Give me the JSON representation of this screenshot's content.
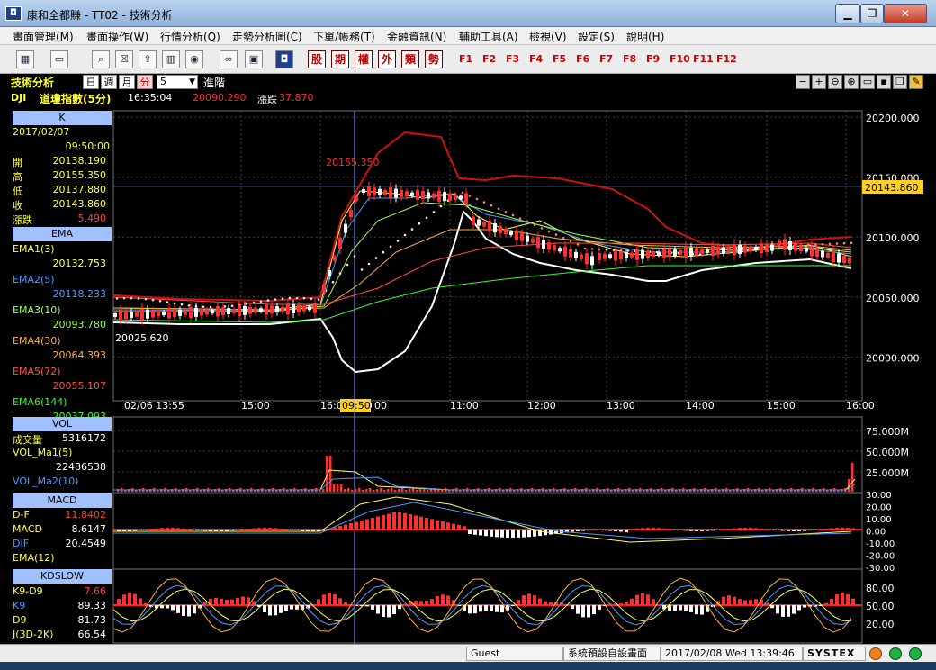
{
  "window": {
    "title": "康和全都賺 - TT02 - 技術分析",
    "minimize": "▁",
    "maximize": "❐",
    "close": "✕"
  },
  "menu": [
    "畫面管理(M)",
    "畫面操作(W)",
    "行情分析(Q)",
    "走勢分析圖(C)",
    "下單/帳務(T)",
    "金融資訊(N)",
    "輔助工具(A)",
    "檢視(V)",
    "設定(S)",
    "說明(H)"
  ],
  "toolbar": {
    "icons": [
      "layout-icon",
      "monitor-icon",
      "search-icon",
      "close-box-icon",
      "export-icon",
      "chart-box-icon",
      "globe-icon",
      "link-icon",
      "window-icon",
      "logo-icon"
    ],
    "quick": [
      "股",
      "期",
      "權",
      "外",
      "類",
      "勢"
    ],
    "fkeys": [
      "F1",
      "F2",
      "F3",
      "F4",
      "F5",
      "F6",
      "F7",
      "F8",
      "F9",
      "F10",
      "F11",
      "F12"
    ]
  },
  "header": {
    "title": "技術分析",
    "periods": [
      "日",
      "週",
      "月",
      "分"
    ],
    "active_period": "分",
    "interval": "5",
    "mode": "進階"
  },
  "info": {
    "symbol": "DJI",
    "name": "道瓊指數(5分)",
    "time": "16:35:04",
    "price": "20090.290",
    "change_label": "漲跌",
    "change": "37.870"
  },
  "left": {
    "k_title": "K",
    "date": "2017/02/07",
    "time": "09:50:00",
    "ohlc": [
      {
        "label": "開",
        "value": "20138.190"
      },
      {
        "label": "高",
        "value": "20155.350"
      },
      {
        "label": "低",
        "value": "20137.880"
      },
      {
        "label": "收",
        "value": "20143.860"
      },
      {
        "label": "漲跌",
        "value": "5.490"
      }
    ],
    "ema_title": "EMA",
    "ema": [
      {
        "label": "EMA1(3)",
        "value": "20132.753",
        "color": "#ffff60"
      },
      {
        "label": "EMA2(5)",
        "value": "20118.233",
        "color": "#4a9cff"
      },
      {
        "label": "EMA3(10)",
        "value": "20093.780",
        "color": "#9cff4a"
      },
      {
        "label": "EMA4(30)",
        "value": "20064.393",
        "color": "#ffb040"
      },
      {
        "label": "EMA5(72)",
        "value": "20055.107",
        "color": "#ff5040"
      },
      {
        "label": "EMA6(144)",
        "value": "20037.093",
        "color": "#30ff30"
      }
    ],
    "vol_title": "VOL",
    "vol": [
      {
        "label": "成交量",
        "value": "5316172"
      },
      {
        "label": "VOL_Ma1(5)",
        "value": ""
      },
      {
        "label": "",
        "value": "22486538"
      },
      {
        "label": "VOL_Ma2(10)",
        "value": ""
      }
    ],
    "macd_title": "MACD",
    "macd": [
      {
        "label": "D-F",
        "value": "11.8402"
      },
      {
        "label": "MACD",
        "value": "8.6147"
      },
      {
        "label": "DIF",
        "value": "20.4549"
      },
      {
        "label": "EMA(12)",
        "value": ""
      }
    ],
    "kd_title": "KDSLOW",
    "kd": [
      {
        "label": "K9-D9",
        "value": "7.66"
      },
      {
        "label": "K9",
        "value": "89.33"
      },
      {
        "label": "D9",
        "value": "81.73"
      },
      {
        "label": "J(3D-2K)",
        "value": "66.54"
      }
    ]
  },
  "chart": {
    "price_ticks": [
      "20200.000",
      "20150.000",
      "20100.000",
      "20050.000",
      "20000.000"
    ],
    "current_price": "20143.860",
    "high_label": "20155.350",
    "low_label": "20025.620",
    "time_ticks": [
      "02/06 13:55",
      "15:00",
      "16:00",
      "09:50",
      "00",
      "11:00",
      "12:00",
      "13:00",
      "14:00",
      "15:00",
      "16:00"
    ],
    "vol_ticks": [
      "75.000M",
      "50.000M",
      "25.000M"
    ],
    "macd_ticks": [
      "30.00",
      "20.00",
      "10.00",
      "0.00",
      "-10.00",
      "-20.00",
      "-30.00"
    ],
    "kd_ticks": [
      "80.00",
      "50.00",
      "20.00"
    ]
  },
  "status": {
    "user": "Guest",
    "screen": "系統預設自設畫面",
    "datetime": "2017/02/08 Wed 13:39:46",
    "brand": "SYSTEX"
  }
}
